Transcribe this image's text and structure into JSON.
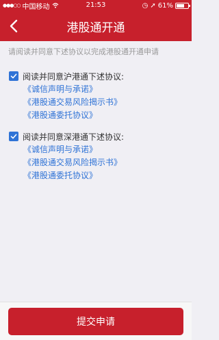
{
  "status_bar": {
    "carrier": "中国移动",
    "time": "21:53",
    "battery": "61%"
  },
  "nav": {
    "title": "港股通开通"
  },
  "intro": "请阅读并同意下述协议以完成港股通开通申请",
  "agreements": [
    {
      "checked": true,
      "label": "阅读并同意沪港通下述协议:",
      "links": [
        "《诚信声明与承诺》",
        "《港股通交易风险揭示书》",
        "《港股通委托协议》"
      ]
    },
    {
      "checked": true,
      "label": "阅读并同意深港通下述协议:",
      "links": [
        "《诚信声明与承诺》",
        "《港股通交易风险揭示书》",
        "《港股通委托协议》"
      ]
    }
  ],
  "submit_label": "提交申请",
  "colors": {
    "brand_red": "#c7202c",
    "link_blue": "#2f73d6",
    "background": "#f0eff4"
  }
}
